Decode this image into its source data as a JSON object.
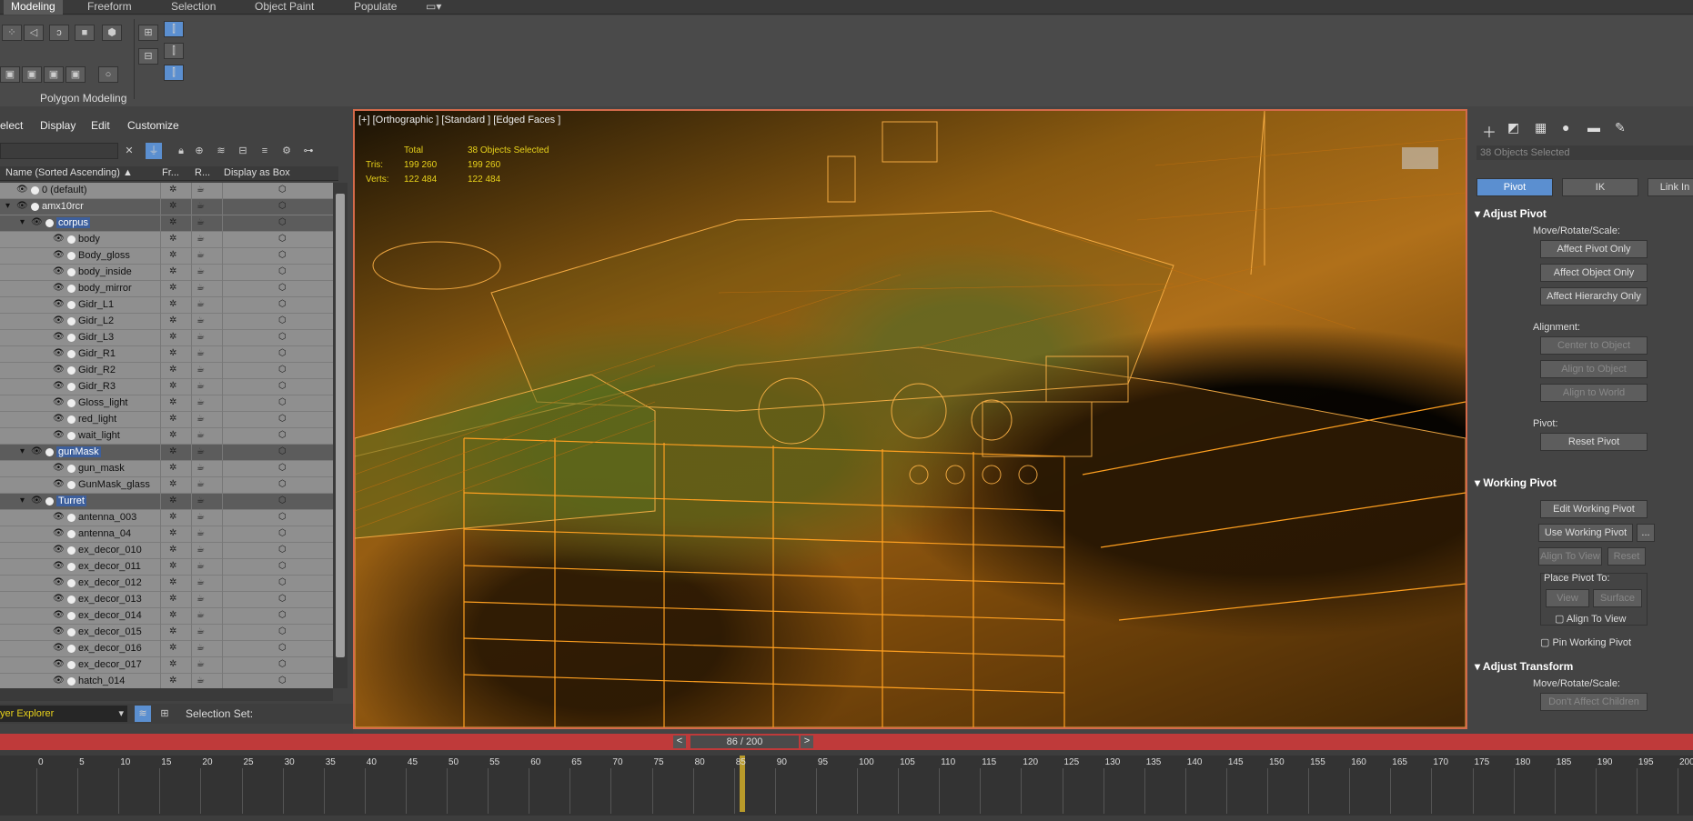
{
  "tabs": [
    "Modeling",
    "Freeform",
    "Selection",
    "Object Paint",
    "Populate"
  ],
  "ribbon": {
    "group_label": "Polygon Modeling"
  },
  "scene": {
    "menu": [
      "elect",
      "Display",
      "Edit",
      "Customize"
    ],
    "columns": [
      "Name (Sorted Ascending)",
      "Fr...",
      "R...",
      "Display as Box"
    ],
    "rows": [
      {
        "name": "0 (default)",
        "level": 0,
        "parent": false
      },
      {
        "name": "amx10rcr",
        "level": 0,
        "parent": true
      },
      {
        "name": "corpus",
        "level": 1,
        "parent": true,
        "hl": true
      },
      {
        "name": "body",
        "level": 2
      },
      {
        "name": "Body_gloss",
        "level": 2
      },
      {
        "name": "body_inside",
        "level": 2
      },
      {
        "name": "body_mirror",
        "level": 2
      },
      {
        "name": "Gidr_L1",
        "level": 2
      },
      {
        "name": "Gidr_L2",
        "level": 2
      },
      {
        "name": "Gidr_L3",
        "level": 2
      },
      {
        "name": "Gidr_R1",
        "level": 2
      },
      {
        "name": "Gidr_R2",
        "level": 2
      },
      {
        "name": "Gidr_R3",
        "level": 2
      },
      {
        "name": "Gloss_light",
        "level": 2
      },
      {
        "name": "red_light",
        "level": 2
      },
      {
        "name": "wait_light",
        "level": 2
      },
      {
        "name": "gunMask",
        "level": 1,
        "parent": true,
        "hl": true
      },
      {
        "name": "gun_mask",
        "level": 2
      },
      {
        "name": "GunMask_glass",
        "level": 2
      },
      {
        "name": "Turret",
        "level": 1,
        "parent": true,
        "hl": true
      },
      {
        "name": "antenna_003",
        "level": 2
      },
      {
        "name": "antenna_04",
        "level": 2
      },
      {
        "name": "ex_decor_010",
        "level": 2
      },
      {
        "name": "ex_decor_011",
        "level": 2
      },
      {
        "name": "ex_decor_012",
        "level": 2
      },
      {
        "name": "ex_decor_013",
        "level": 2
      },
      {
        "name": "ex_decor_014",
        "level": 2
      },
      {
        "name": "ex_decor_015",
        "level": 2
      },
      {
        "name": "ex_decor_016",
        "level": 2
      },
      {
        "name": "ex_decor_017",
        "level": 2
      },
      {
        "name": "hatch_014",
        "level": 2
      }
    ],
    "explorer_label": "yer Explorer",
    "selection_set": "Selection Set:"
  },
  "viewport": {
    "label": "[+] [Orthographic ] [Standard ] [Edged Faces ]",
    "stats": {
      "h1": "Total",
      "h2": "38 Objects Selected",
      "tris_label": "Tris:",
      "tris_total": "199 260",
      "tris_sel": "199 260",
      "verts_label": "Verts:",
      "verts_total": "122 484",
      "verts_sel": "122 484"
    }
  },
  "command": {
    "selected": "38 Objects Selected",
    "tabs": [
      "Pivot",
      "IK",
      "Link In"
    ],
    "adjust_pivot": "Adjust Pivot",
    "mrs": "Move/Rotate/Scale:",
    "affect_pivot": "Affect Pivot Only",
    "affect_object": "Affect Object Only",
    "affect_hierarchy": "Affect Hierarchy Only",
    "alignment": "Alignment:",
    "center": "Center to Object",
    "align_obj": "Align to Object",
    "align_world": "Align to World",
    "pivot": "Pivot:",
    "reset_pivot": "Reset Pivot",
    "working_pivot": "Working Pivot",
    "edit_wp": "Edit Working Pivot",
    "use_wp": "Use Working Pivot",
    "dots": "...",
    "align_view": "Align To View",
    "reset": "Reset",
    "place_to": "Place Pivot To:",
    "view": "View",
    "surface": "Surface",
    "align_to_view": "Align To View",
    "pin": "Pin Working Pivot",
    "adjust_transform": "Adjust Transform",
    "mrs2": "Move/Rotate/Scale:",
    "dont_affect": "Don't Affect Children"
  },
  "timeline": {
    "frame": "86 / 200",
    "ticks": [
      "0",
      "5",
      "10",
      "15",
      "20",
      "25",
      "30",
      "35",
      "40",
      "45",
      "50",
      "55",
      "60",
      "65",
      "70",
      "75",
      "80",
      "85",
      "90",
      "95",
      "100",
      "105",
      "110",
      "115",
      "120",
      "125",
      "130",
      "135",
      "140",
      "145",
      "150",
      "155",
      "160",
      "165",
      "170",
      "175",
      "180",
      "185",
      "190",
      "195",
      "200"
    ],
    "current": 86,
    "total": 200
  }
}
